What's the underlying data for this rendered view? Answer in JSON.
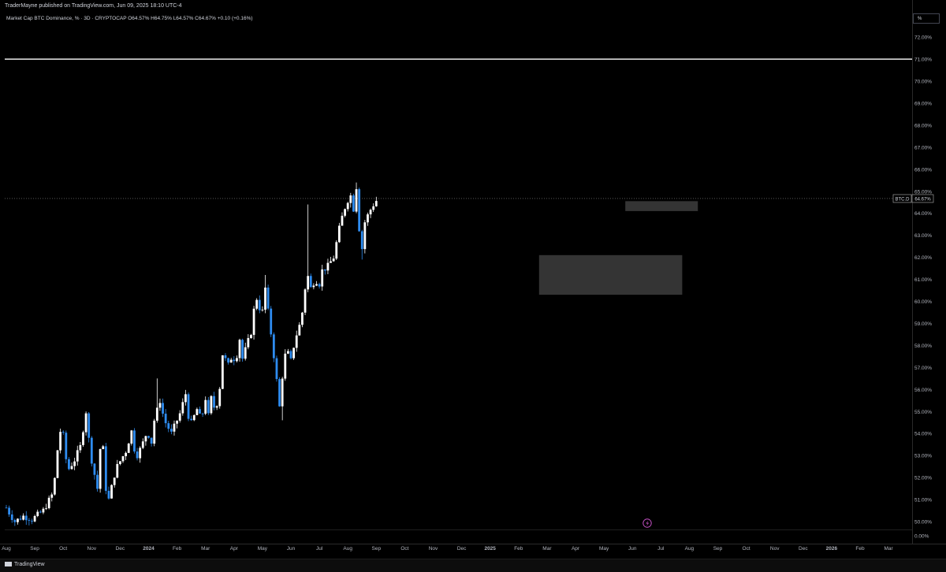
{
  "header": {
    "published": "TraderMayne published on TradingView.com, Jun 09, 2025 18:10 UTC-4",
    "legend": "Market Cap BTC Dominance, % · 3D · CRYPTOCAP O64.57% H64.75% L64.57% C64.67% +0.10 (+0.16%)",
    "unit_button": "%"
  },
  "footer": {
    "brand": "TradingView"
  },
  "chart_data": {
    "type": "candlestick",
    "symbol_label": "BTC.D",
    "last_value_label": "64.67%",
    "last_value": 64.67,
    "y_axis": {
      "ticks": [
        0.0,
        50.0,
        51.0,
        52.0,
        53.0,
        54.0,
        55.0,
        56.0,
        57.0,
        58.0,
        59.0,
        60.0,
        61.0,
        62.0,
        63.0,
        64.0,
        65.0,
        66.0,
        67.0,
        68.0,
        69.0,
        70.0,
        71.0,
        72.0
      ],
      "tick_labels": [
        "0.00%",
        "50.00%",
        "51.00%",
        "52.00%",
        "53.00%",
        "54.00%",
        "55.00%",
        "56.00%",
        "57.00%",
        "58.00%",
        "59.00%",
        "60.00%",
        "61.00%",
        "62.00%",
        "63.00%",
        "64.00%",
        "65.00%",
        "66.00%",
        "67.00%",
        "68.00%",
        "69.00%",
        "70.00%",
        "71.00%",
        "72.00%"
      ]
    },
    "x_axis": {
      "tick_labels": [
        "Aug",
        "Sep",
        "Oct",
        "Nov",
        "Dec",
        "2024",
        "Feb",
        "Mar",
        "Apr",
        "May",
        "Jun",
        "Jul",
        "Aug",
        "Sep",
        "Oct",
        "Nov",
        "Dec",
        "2025",
        "Feb",
        "Mar",
        "Apr",
        "May",
        "Jun",
        "Jul",
        "Aug",
        "Sep",
        "Oct",
        "Nov",
        "Dec",
        "2026",
        "Feb",
        "Mar"
      ],
      "tick_times": [
        0,
        1,
        2,
        3,
        4,
        5,
        6,
        7,
        8,
        9,
        10,
        11,
        12,
        13,
        14,
        15,
        16,
        17,
        18,
        19,
        20,
        21,
        22,
        23,
        24,
        25,
        26,
        27,
        28,
        29,
        30,
        31
      ],
      "bold_labels": [
        "2024",
        "2025",
        "2026"
      ],
      "unit": "months since the Aug 2023 tick"
    },
    "horizontal_line": {
      "value": 71.0,
      "color": "#ffffff"
    },
    "current_price_line": {
      "value": 64.67,
      "style": "dotted"
    },
    "zones": [
      {
        "t0": 18.72,
        "t1": 23.75,
        "low": 60.3,
        "high": 62.1,
        "color": "#3a3a3a"
      },
      {
        "t0": 21.75,
        "t1": 24.3,
        "low": 64.1,
        "high": 64.55,
        "color": "#3a3a3a"
      }
    ],
    "candle_colors": {
      "up": "#ffffff",
      "down": "#2e8cf0"
    },
    "anchors": [
      [
        -0.03,
        50.7
      ],
      [
        0.1,
        50.4
      ],
      [
        0.3,
        50.0
      ],
      [
        0.6,
        50.25
      ],
      [
        0.9,
        50.1
      ],
      [
        1.0,
        50.2
      ],
      [
        1.3,
        50.5
      ],
      [
        1.6,
        51.2
      ],
      [
        1.75,
        52.3
      ],
      [
        1.85,
        54.2
      ],
      [
        2.0,
        53.9
      ],
      [
        2.15,
        52.3
      ],
      [
        2.4,
        52.8
      ],
      [
        2.6,
        53.4
      ],
      [
        2.8,
        55.0
      ],
      [
        2.95,
        53.1
      ],
      [
        3.2,
        51.5
      ],
      [
        3.35,
        54.2
      ],
      [
        3.5,
        51.5
      ],
      [
        3.6,
        51.0
      ],
      [
        3.85,
        52.4
      ],
      [
        4.2,
        53.2
      ],
      [
        4.4,
        54.1
      ],
      [
        4.55,
        52.9
      ],
      [
        4.75,
        53.4
      ],
      [
        4.95,
        54.1
      ],
      [
        5.1,
        53.6
      ],
      [
        5.2,
        54.6
      ],
      [
        5.4,
        55.5
      ],
      [
        5.55,
        54.6
      ],
      [
        5.8,
        54.0
      ],
      [
        6.1,
        54.9
      ],
      [
        6.3,
        55.8
      ],
      [
        6.45,
        54.3
      ],
      [
        6.7,
        55.1
      ],
      [
        6.85,
        54.6
      ],
      [
        7.0,
        55.6
      ],
      [
        7.1,
        54.8
      ],
      [
        7.2,
        55.6
      ],
      [
        7.35,
        55.0
      ],
      [
        7.5,
        56.1
      ],
      [
        7.6,
        57.6
      ],
      [
        7.8,
        57.1
      ],
      [
        7.95,
        57.6
      ],
      [
        8.05,
        57.2
      ],
      [
        8.2,
        58.3
      ],
      [
        8.3,
        57.4
      ],
      [
        8.45,
        58.0
      ],
      [
        8.6,
        58.6
      ],
      [
        8.7,
        59.6
      ],
      [
        8.85,
        60.4
      ],
      [
        8.95,
        59.0
      ],
      [
        9.1,
        60.6
      ],
      [
        9.25,
        59.0
      ],
      [
        9.35,
        58.1
      ],
      [
        9.5,
        56.4
      ],
      [
        9.6,
        55.2
      ],
      [
        9.75,
        57.3
      ],
      [
        9.85,
        57.8
      ],
      [
        10.0,
        57.3
      ],
      [
        10.15,
        58.3
      ],
      [
        10.3,
        58.9
      ],
      [
        10.45,
        59.8
      ],
      [
        10.55,
        61.4
      ],
      [
        10.7,
        60.6
      ],
      [
        10.85,
        61.0
      ],
      [
        11.0,
        60.8
      ],
      [
        11.1,
        61.4
      ],
      [
        11.3,
        61.6
      ],
      [
        11.5,
        62.0
      ],
      [
        11.7,
        63.3
      ],
      [
        11.85,
        64.1
      ],
      [
        12.0,
        64.6
      ],
      [
        12.1,
        64.8
      ],
      [
        12.2,
        64.2
      ],
      [
        12.3,
        65.2
      ],
      [
        12.4,
        63.3
      ],
      [
        12.5,
        62.4
      ],
      [
        12.6,
        63.6
      ],
      [
        12.7,
        63.9
      ],
      [
        12.85,
        64.3
      ],
      [
        13.0,
        64.57
      ]
    ],
    "wicks": [
      {
        "t": 9.1,
        "high": 61.2
      },
      {
        "t": 9.7,
        "low": 54.6
      },
      {
        "t": 10.6,
        "high": 64.4
      },
      {
        "t": 12.3,
        "high": 65.4
      },
      {
        "t": 12.5,
        "low": 61.9
      },
      {
        "t": 5.3,
        "high": 56.5
      }
    ]
  }
}
